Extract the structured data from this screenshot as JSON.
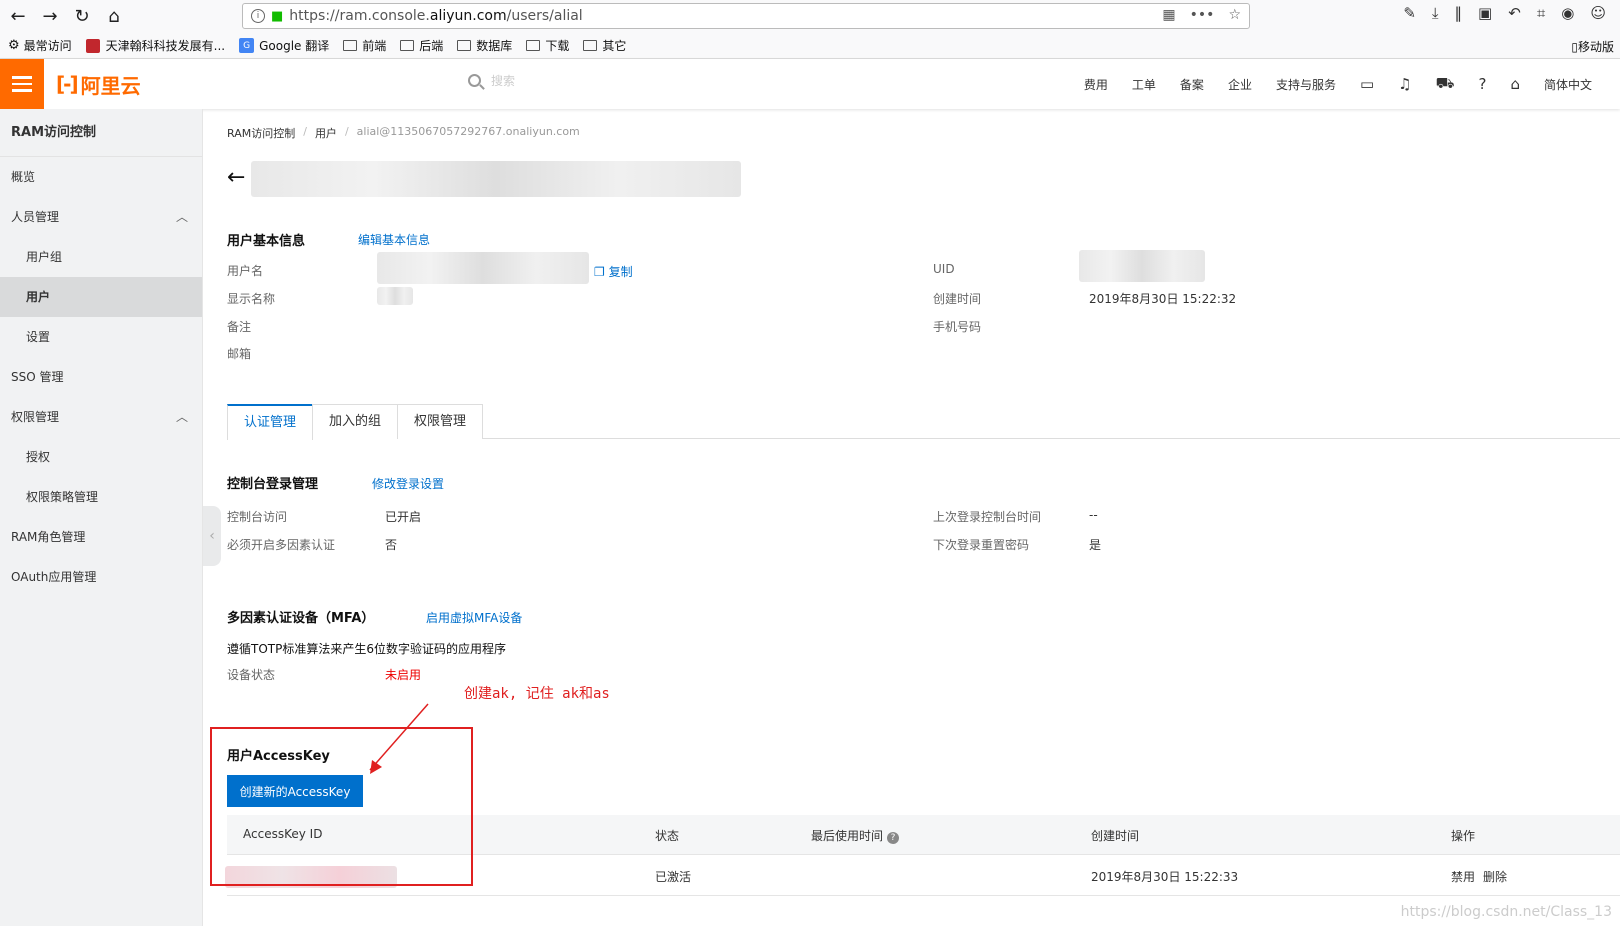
{
  "browser": {
    "url_prefix": "https://ram.console.",
    "url_domain": "aliyun.com",
    "url_suffix": "/users/alial",
    "bookmarks": [
      "最常访问",
      "天津翰科科技发展有...",
      "Google 翻译",
      "前端",
      "后端",
      "数据库",
      "下载",
      "其它"
    ],
    "mobile_bookmarks": "移动版"
  },
  "header": {
    "logo": "阿里云",
    "search_placeholder": "搜索",
    "links": [
      "费用",
      "工单",
      "备案",
      "企业",
      "支持与服务"
    ],
    "lang": "简体中文"
  },
  "sidebar": {
    "title": "RAM访问控制",
    "items": [
      {
        "label": "概览"
      },
      {
        "label": "人员管理"
      },
      {
        "label": "用户组"
      },
      {
        "label": "用户"
      },
      {
        "label": "设置"
      },
      {
        "label": "SSO 管理"
      },
      {
        "label": "权限管理"
      },
      {
        "label": "授权"
      },
      {
        "label": "权限策略管理"
      },
      {
        "label": "RAM角色管理"
      },
      {
        "label": "OAuth应用管理"
      }
    ]
  },
  "breadcrumb": {
    "root": "RAM访问控制",
    "users": "用户",
    "current": "alial@1135067057292767.onaliyun.com"
  },
  "basic": {
    "title": "用户基本信息",
    "edit": "编辑基本信息",
    "labels": [
      "用户名",
      "显示名称",
      "备注",
      "邮箱"
    ],
    "copy": "复制",
    "uid_label": "UID",
    "created_label": "创建时间",
    "created_value": "2019年8月30日 15:22:32",
    "phone_label": "手机号码"
  },
  "tabs": [
    "认证管理",
    "加入的组",
    "权限管理"
  ],
  "login": {
    "title": "控制台登录管理",
    "edit": "修改登录设置",
    "access_label": "控制台访问",
    "access_value": "已开启",
    "mfa_label": "必须开启多因素认证",
    "mfa_value": "否",
    "last_login_label": "上次登录控制台时间",
    "last_login_value": "--",
    "reset_label": "下次登录重置密码",
    "reset_value": "是"
  },
  "mfa": {
    "title": "多因素认证设备（MFA）",
    "enable": "启用虚拟MFA设备",
    "desc": "遵循TOTP标准算法来产生6位数字验证码的应用程序",
    "status_label": "设备状态",
    "status_value": "未启用"
  },
  "accesskey": {
    "title": "用户AccessKey",
    "create_button": "创建新的AccessKey",
    "columns": [
      "AccessKey ID",
      "状态",
      "最后使用时间",
      "创建时间",
      "操作"
    ],
    "row": {
      "status": "已激活",
      "created": "2019年8月30日 15:22:33",
      "disable": "禁用",
      "delete": "删除"
    }
  },
  "annotation": "创建ak, 记住 ak和as",
  "watermark": "https://blog.csdn.net/Class_13",
  "colors": {
    "brand": "#ff6a00",
    "link": "#0070cc",
    "annotation": "#e02020"
  }
}
